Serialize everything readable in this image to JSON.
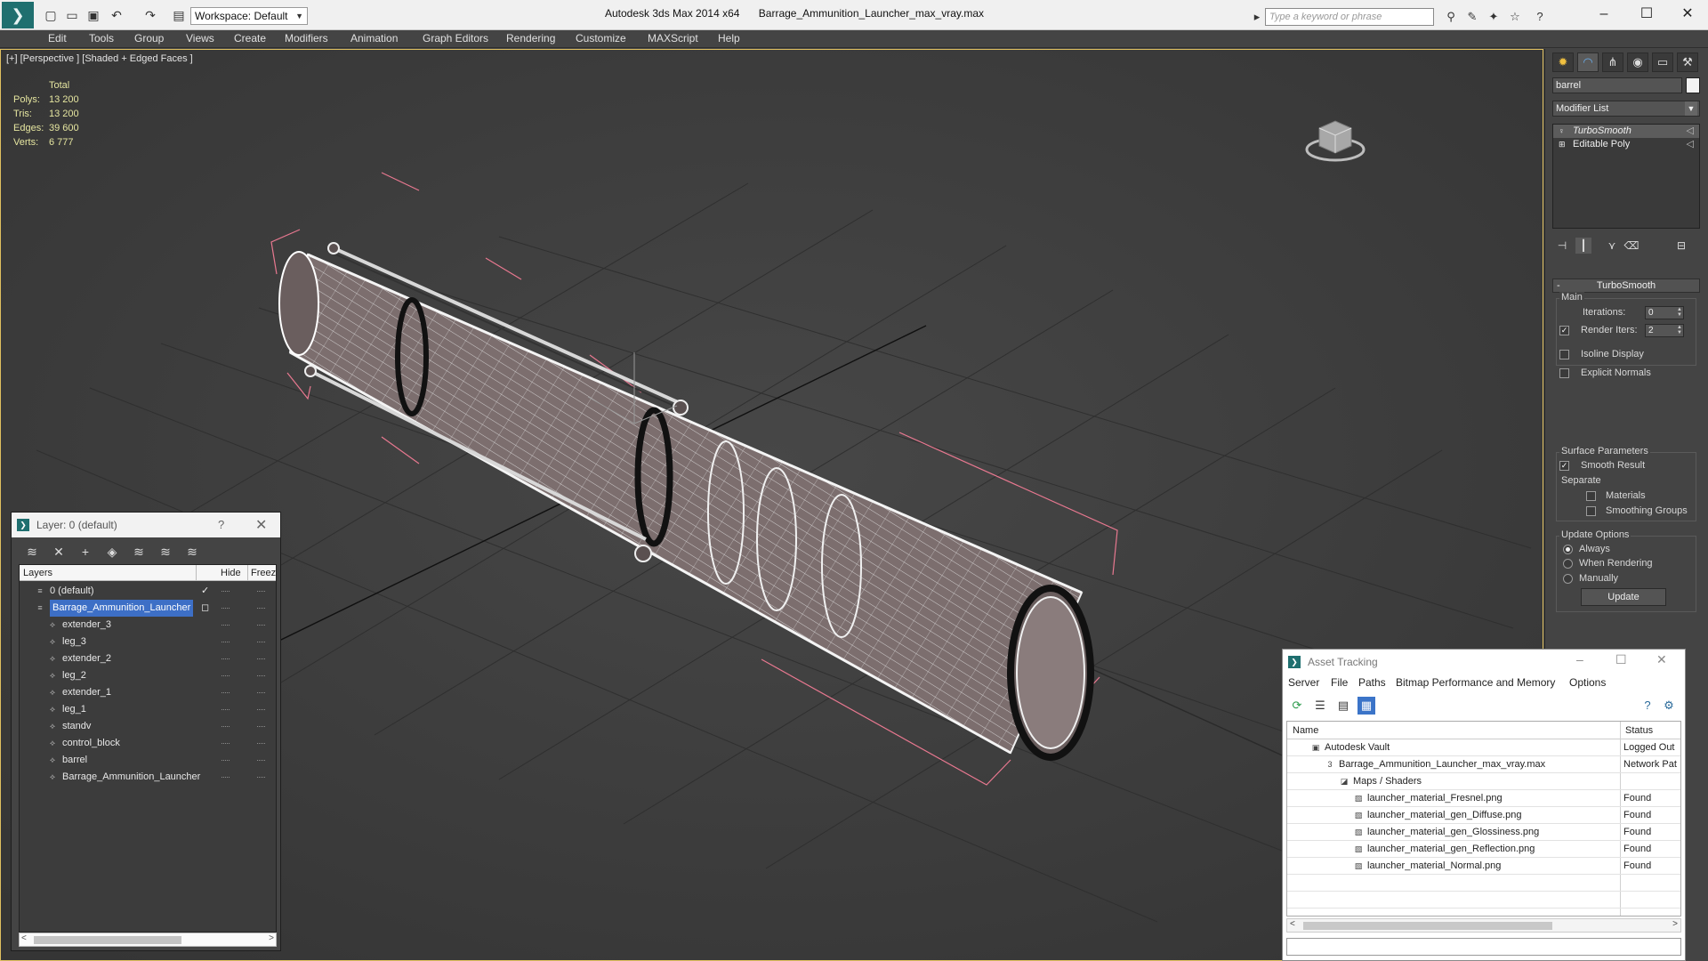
{
  "titlebar": {
    "workspace": "Workspace: Default",
    "app_name": "Autodesk 3ds Max  2014 x64",
    "file_name": "Barrage_Ammunition_Launcher_max_vray.max",
    "search_placeholder": "Type a keyword or phrase"
  },
  "menu": [
    "Edit",
    "Tools",
    "Group",
    "Views",
    "Create",
    "Modifiers",
    "Animation",
    "Graph Editors",
    "Rendering",
    "Customize",
    "MAXScript",
    "Help"
  ],
  "viewport": {
    "label": "[+] [Perspective ] [Shaded + Edged Faces ]",
    "stats": {
      "header": "Total",
      "rows": [
        {
          "label": "Polys:",
          "value": "13 200"
        },
        {
          "label": "Tris:",
          "value": "13 200"
        },
        {
          "label": "Edges:",
          "value": "39 600"
        },
        {
          "label": "Verts:",
          "value": "6 777"
        }
      ]
    }
  },
  "command_panel": {
    "object_name": "barrel",
    "modifier_list": "Modifier List",
    "stack": [
      {
        "label": "TurboSmooth",
        "selected": true
      },
      {
        "label": "Editable Poly",
        "selected": false
      }
    ],
    "rollout_title": "TurboSmooth",
    "main_group": "Main",
    "iterations_label": "Iterations:",
    "iterations_value": "0",
    "render_iters_label": "Render Iters:",
    "render_iters_value": "2",
    "isoline_label": "Isoline Display",
    "explicit_normals_label": "Explicit Normals",
    "surface_group": "Surface Parameters",
    "smooth_result_label": "Smooth Result",
    "separate_label": "Separate",
    "materials_label": "Materials",
    "smoothing_groups_label": "Smoothing Groups",
    "update_group": "Update Options",
    "always_label": "Always",
    "when_rendering_label": "When Rendering",
    "manually_label": "Manually",
    "update_button": "Update"
  },
  "layer_window": {
    "title": "Layer: 0 (default)",
    "help": "?",
    "col_layers": "Layers",
    "col_hide": "Hide",
    "col_freeze": "Freez",
    "rows": [
      {
        "name": "0 (default)",
        "indent": 1,
        "marker": "✓",
        "selected": false
      },
      {
        "name": "Barrage_Ammunition_Launcher",
        "indent": 1,
        "marker": "◻",
        "selected": true
      },
      {
        "name": "extender_3",
        "indent": 2,
        "marker": "",
        "selected": false
      },
      {
        "name": "leg_3",
        "indent": 2,
        "marker": "",
        "selected": false
      },
      {
        "name": "extender_2",
        "indent": 2,
        "marker": "",
        "selected": false
      },
      {
        "name": "leg_2",
        "indent": 2,
        "marker": "",
        "selected": false
      },
      {
        "name": "extender_1",
        "indent": 2,
        "marker": "",
        "selected": false
      },
      {
        "name": "leg_1",
        "indent": 2,
        "marker": "",
        "selected": false
      },
      {
        "name": "standv",
        "indent": 2,
        "marker": "",
        "selected": false
      },
      {
        "name": "control_block",
        "indent": 2,
        "marker": "",
        "selected": false
      },
      {
        "name": "barrel",
        "indent": 2,
        "marker": "",
        "selected": false
      },
      {
        "name": "Barrage_Ammunition_Launcher",
        "indent": 2,
        "marker": "",
        "selected": false
      }
    ]
  },
  "asset_window": {
    "title": "Asset Tracking",
    "menu": [
      "Server",
      "File",
      "Paths",
      "Bitmap Performance and Memory",
      "Options"
    ],
    "col_name": "Name",
    "col_status": "Status",
    "rows": [
      {
        "name": "Autodesk Vault",
        "indent": 1,
        "status": "Logged Out"
      },
      {
        "name": "Barrage_Ammunition_Launcher_max_vray.max",
        "indent": 2,
        "status": "Network Pat"
      },
      {
        "name": "Maps / Shaders",
        "indent": 3,
        "status": ""
      },
      {
        "name": "launcher_material_Fresnel.png",
        "indent": 4,
        "status": "Found"
      },
      {
        "name": "launcher_material_gen_Diffuse.png",
        "indent": 4,
        "status": "Found"
      },
      {
        "name": "launcher_material_gen_Glossiness.png",
        "indent": 4,
        "status": "Found"
      },
      {
        "name": "launcher_material_gen_Reflection.png",
        "indent": 4,
        "status": "Found"
      },
      {
        "name": "launcher_material_Normal.png",
        "indent": 4,
        "status": "Found"
      }
    ]
  },
  "colors": {
    "viewport_bg": "#404040",
    "selection_blue": "#3d6fc6",
    "bbox_pink": "#e87890",
    "stats_yellow": "#e6e6a0"
  }
}
